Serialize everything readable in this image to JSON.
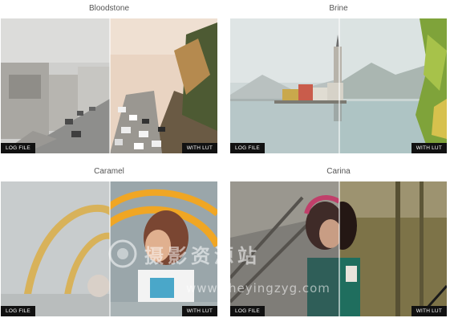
{
  "gallery": {
    "items": [
      {
        "title": "Bloodstone",
        "left_label": "LOG FILE",
        "right_label": "WITH LUT"
      },
      {
        "title": "Brine",
        "left_label": "LOG FILE",
        "right_label": "WITH LUT"
      },
      {
        "title": "Caramel",
        "left_label": "LOG FILE",
        "right_label": "WITH LUT"
      },
      {
        "title": "Carina",
        "left_label": "LOG FILE",
        "right_label": "WITH LUT"
      }
    ]
  },
  "watermark": {
    "cn_text": "摄影资源站",
    "url": "www.sheyingzyg.com"
  }
}
